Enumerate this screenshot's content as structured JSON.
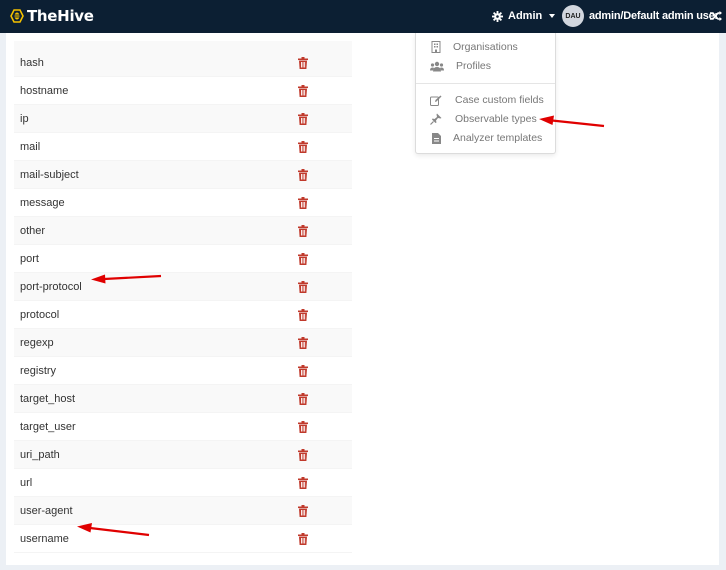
{
  "navbar": {
    "app_name": "TheHive",
    "admin_label": "Admin",
    "user_initials": "DAU",
    "user_label": "admin/Default admin user"
  },
  "admin_dropdown": {
    "items": [
      {
        "label": "Organisations",
        "icon": "building-icon"
      },
      {
        "label": "Profiles",
        "icon": "users-icon"
      },
      {
        "label": "Case custom fields",
        "icon": "edit-icon"
      },
      {
        "label": "Observable types",
        "icon": "pin-icon"
      },
      {
        "label": "Analyzer templates",
        "icon": "file-icon"
      }
    ]
  },
  "observable_types": [
    "hash",
    "hostname",
    "ip",
    "mail",
    "mail-subject",
    "message",
    "other",
    "port",
    "port-protocol",
    "protocol",
    "regexp",
    "registry",
    "target_host",
    "target_user",
    "uri_path",
    "url",
    "user-agent",
    "username"
  ],
  "colors": {
    "navbar_bg": "#0c1f33",
    "logo_bee": "#f3c000",
    "trash_icon": "#c0392b",
    "annotation_arrow": "#e00000"
  }
}
